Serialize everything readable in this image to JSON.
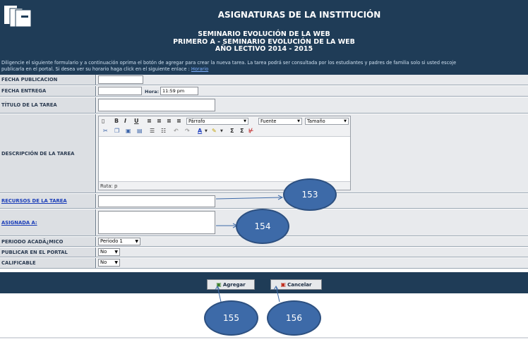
{
  "header": {
    "title": "ASIGNATURAS DE LA INSTITUCIÓN",
    "subtitle_lines": [
      "SEMINARIO EVOLUCIÓN DE LA WEB",
      "PRIMERO A - SEMINARIO EVOLUCIÓN DE LA WEB",
      "AÑO LECTIVO 2014 - 2015"
    ]
  },
  "instructions": {
    "line1": "Diligencie el siguiente formulario y a continuación oprima el botón de agregar para crear la nueva tarea. La tarea podrá ser consultada por los estudiantes y padres de familia solo si usted escoje",
    "line2": "publicarla en el portal. Si desea ver su horario haga click en el siguiente enlace :",
    "link": "Horario"
  },
  "form": {
    "fecha_publicacion": {
      "label": "FECHA PUBLICACION",
      "value": ""
    },
    "fecha_entrega": {
      "label": "FECHA ENTREGA",
      "value": "",
      "hora_label": "Hora:",
      "hora_value": "11:59 pm"
    },
    "titulo": {
      "label": "TÍTULO DE LA TAREA",
      "value": ""
    },
    "descripcion": {
      "label": "DESCRIPCIÓN DE LA TAREA",
      "toolbar": {
        "bold": "B",
        "italic": "I",
        "underline": "U",
        "format_select": "Párrafo",
        "font_select": "Fuente",
        "size_select": "Tamaño"
      },
      "path": "Ruta: p"
    },
    "recursos": {
      "label": "RECURSOS DE LA TAREA"
    },
    "asignada": {
      "label": "ASIGNADA A:"
    },
    "periodo": {
      "label": "PERIODO ACADÃ¿MICO",
      "value": "Periodo 1"
    },
    "publicar": {
      "label": "PUBLICAR EN EL PORTAL",
      "value": "No"
    },
    "calificable": {
      "label": "CALIFICABLE",
      "value": "No"
    }
  },
  "buttons": {
    "agregar": "Agregar",
    "cancelar": "Cancelar"
  },
  "annotations": [
    "153",
    "154",
    "155",
    "156"
  ],
  "colors": {
    "header_bg": "#1f3c57",
    "bubble": "#3d6aa8",
    "link": "#1a3db8"
  }
}
